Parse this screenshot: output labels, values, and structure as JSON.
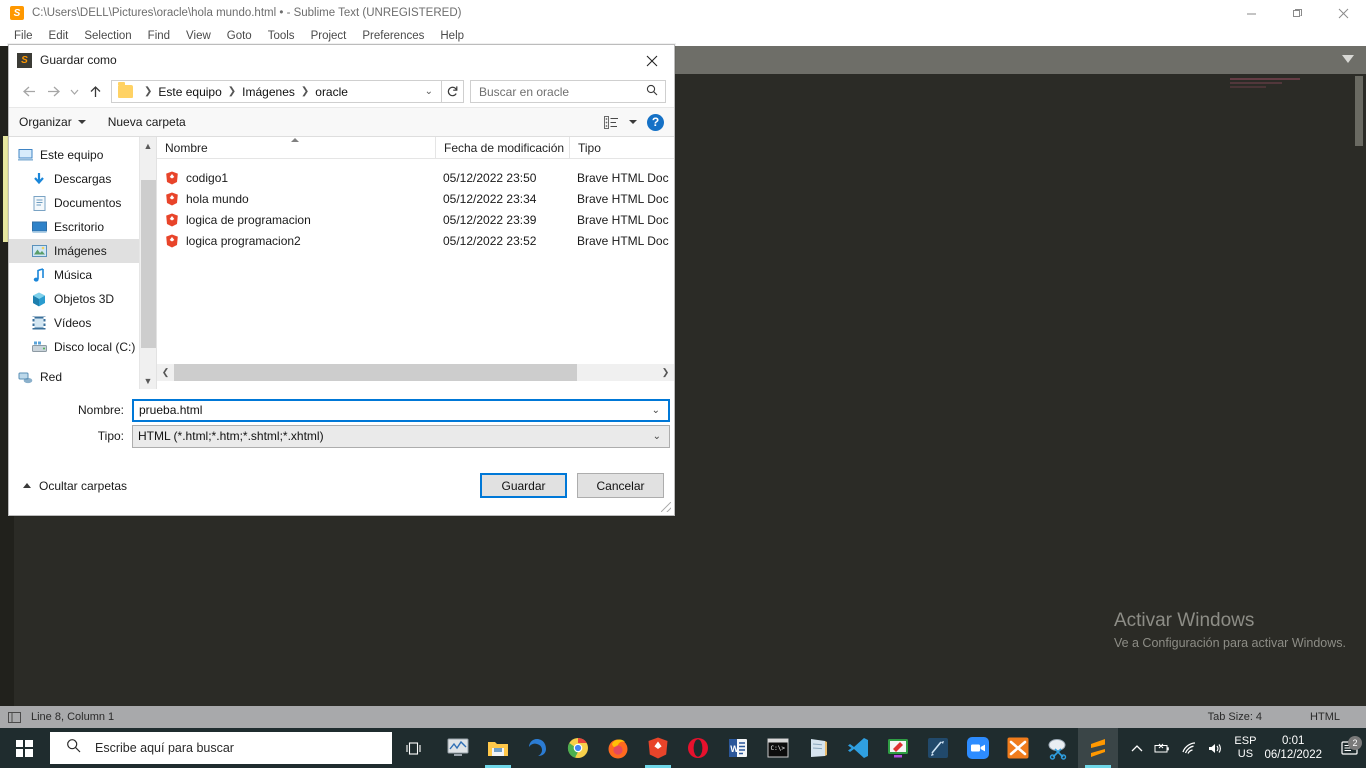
{
  "sublime": {
    "title": "C:\\Users\\DELL\\Pictures\\oracle\\hola mundo.html • - Sublime Text (UNREGISTERED)",
    "icon": "sublime-icon",
    "menu": [
      "File",
      "Edit",
      "Selection",
      "Find",
      "View",
      "Goto",
      "Tools",
      "Project",
      "Preferences",
      "Help"
    ],
    "window_controls": [
      "minimize",
      "maximize",
      "close"
    ],
    "watermark": {
      "title": "Activar Windows",
      "subtitle": "Ve a Configuración para activar Windows."
    },
    "statusbar": {
      "position": "Line 8, Column 1",
      "tab_size": "Tab Size: 4",
      "syntax": "HTML"
    }
  },
  "dialog": {
    "title": "Guardar como",
    "close_label": "✕",
    "nav": {
      "back": "←",
      "forward": "→",
      "recent": "⌄",
      "up": "↑",
      "refresh": "↻",
      "breadcrumbs": [
        "Este equipo",
        "Imágenes",
        "oracle"
      ],
      "breadcrumb_caret": "⌄",
      "search_placeholder": "Buscar en oracle"
    },
    "toolbar": {
      "organize": "Organizar",
      "new_folder": "Nueva carpeta",
      "help": "?"
    },
    "sidebar": {
      "items": [
        {
          "label": "Este equipo",
          "icon": "computer-icon",
          "selected": false,
          "root": true
        },
        {
          "label": "Descargas",
          "icon": "downloads-icon",
          "selected": false,
          "root": false
        },
        {
          "label": "Documentos",
          "icon": "documents-icon",
          "selected": false,
          "root": false
        },
        {
          "label": "Escritorio",
          "icon": "desktop-icon",
          "selected": false,
          "root": false
        },
        {
          "label": "Imágenes",
          "icon": "pictures-icon",
          "selected": true,
          "root": false
        },
        {
          "label": "Música",
          "icon": "music-icon",
          "selected": false,
          "root": false
        },
        {
          "label": "Objetos 3D",
          "icon": "objects3d-icon",
          "selected": false,
          "root": false
        },
        {
          "label": "Vídeos",
          "icon": "videos-icon",
          "selected": false,
          "root": false
        },
        {
          "label": "Disco local (C:)",
          "icon": "disk-icon",
          "selected": false,
          "root": false
        },
        {
          "label": "Red",
          "icon": "network-icon",
          "selected": false,
          "root": true
        }
      ]
    },
    "filelist": {
      "columns": [
        "Nombre",
        "Fecha de modificación",
        "Tipo"
      ],
      "sorted_by": "Nombre",
      "rows": [
        {
          "name": "codigo1",
          "date": "05/12/2022 23:50",
          "type": "Brave HTML Doc",
          "icon": "brave-icon"
        },
        {
          "name": "hola mundo",
          "date": "05/12/2022 23:34",
          "type": "Brave HTML Doc",
          "icon": "brave-icon"
        },
        {
          "name": "logica de programacion",
          "date": "05/12/2022 23:39",
          "type": "Brave HTML Doc",
          "icon": "brave-icon"
        },
        {
          "name": "logica programacion2",
          "date": "05/12/2022 23:52",
          "type": "Brave HTML Doc",
          "icon": "brave-icon"
        }
      ]
    },
    "form": {
      "name_label": "Nombre:",
      "name_value": "prueba.html",
      "type_label": "Tipo:",
      "type_value": "HTML (*.html;*.htm;*.shtml;*.xhtml)",
      "caret": "⌄"
    },
    "footer": {
      "hide_folders": "Ocultar carpetas",
      "save": "Guardar",
      "cancel": "Cancelar"
    }
  },
  "taskbar": {
    "start": "start-button",
    "search_placeholder": "Escribe aquí para buscar",
    "task_view": "task-view-button",
    "apps": [
      "system-monitor",
      "file-explorer",
      "edge",
      "chrome",
      "firefox",
      "brave",
      "opera",
      "word",
      "command-prompt",
      "notepad",
      "vscode",
      "paint",
      "tool-app",
      "zoom",
      "xampp",
      "snipping-tool",
      "sublime-text"
    ],
    "tray": {
      "show_hidden": "^",
      "battery": "battery-icon",
      "network": "wifi-icon",
      "volume": "volume-icon",
      "language_top": "ESP",
      "language_bottom": "US",
      "time": "0:01",
      "date": "06/12/2022",
      "notifications_count": "2"
    }
  },
  "colors": {
    "accent": "#0078d7",
    "taskbar_bg": "#1f2c2e",
    "sublime_bg": "#2b2b26",
    "statusbar_bg": "#a8a9ab",
    "brave_orange": "#e8442a"
  }
}
